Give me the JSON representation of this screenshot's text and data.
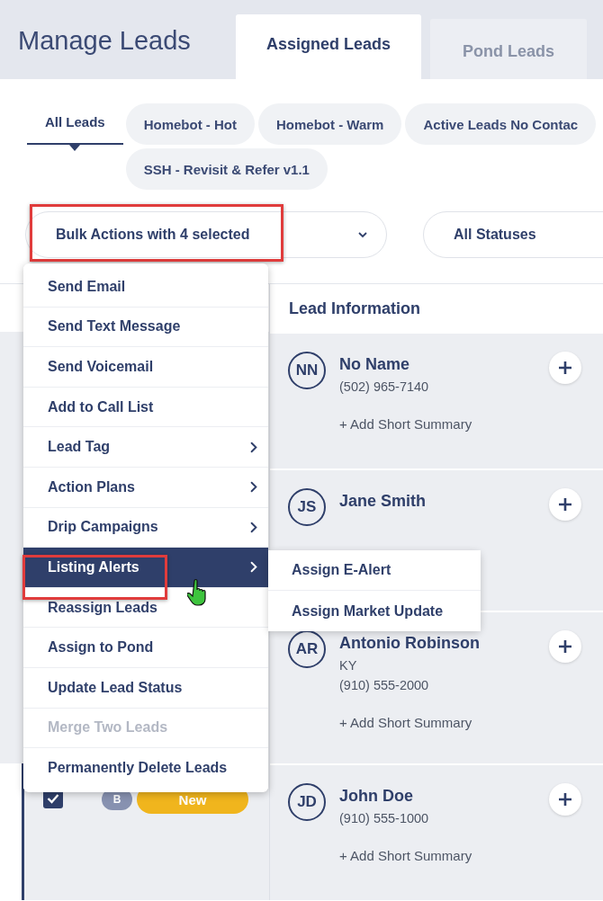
{
  "page_title": "Manage Leads",
  "tabs": [
    {
      "label": "Assigned Leads",
      "selected": true
    },
    {
      "label": "Pond Leads",
      "selected": false
    }
  ],
  "filters": [
    {
      "label": "All Leads",
      "selected": true
    },
    {
      "label": "Homebot - Hot",
      "selected": false
    },
    {
      "label": "Homebot - Warm",
      "selected": false
    },
    {
      "label": "Active Leads No Contac",
      "selected": false
    },
    {
      "label": "SSH - Revisit & Refer v1.1",
      "selected": false
    }
  ],
  "bulk_actions": {
    "value": "Bulk Actions with 4 selected",
    "highlighted": true
  },
  "status_filter": {
    "value": "All Statuses"
  },
  "table": {
    "column_header": "Lead Information",
    "leads": [
      {
        "initials": "NN",
        "name": "No Name",
        "lines": [
          "(502) 965-7140"
        ],
        "summary_link": "+ Add Short Summary"
      },
      {
        "initials": "JS",
        "name": "Jane Smith"
      },
      {
        "initials": "AR",
        "name": "Antonio Robinson",
        "lines": [
          "KY",
          "(910) 555-2000"
        ],
        "summary_link": "+ Add Short Summary"
      },
      {
        "initials": "JD",
        "name": "John Doe",
        "lines": [
          "(910) 555-1000"
        ],
        "summary_link": "+ Add Short Summary",
        "checked": true,
        "badge": "B",
        "status": "New"
      }
    ]
  },
  "bulk_menu": [
    {
      "label": "Send Email",
      "has_submenu": false,
      "selected": false,
      "disabled": false
    },
    {
      "label": "Send Text Message",
      "has_submenu": false,
      "selected": false,
      "disabled": false
    },
    {
      "label": "Send Voicemail",
      "has_submenu": false,
      "selected": false,
      "disabled": false
    },
    {
      "label": "Add to Call List",
      "has_submenu": false,
      "selected": false,
      "disabled": false
    },
    {
      "label": "Lead Tag",
      "has_submenu": true,
      "selected": false,
      "disabled": false
    },
    {
      "label": "Action Plans",
      "has_submenu": true,
      "selected": false,
      "disabled": false
    },
    {
      "label": "Drip Campaigns",
      "has_submenu": true,
      "selected": false,
      "disabled": false
    },
    {
      "label": "Listing Alerts",
      "has_submenu": true,
      "selected": true,
      "disabled": false,
      "highlighted": true
    },
    {
      "label": "Reassign Leads",
      "has_submenu": false,
      "selected": false,
      "disabled": false
    },
    {
      "label": "Assign to Pond",
      "has_submenu": false,
      "selected": false,
      "disabled": false
    },
    {
      "label": "Update Lead Status",
      "has_submenu": false,
      "selected": false,
      "disabled": false
    },
    {
      "label": "Merge Two Leads",
      "has_submenu": false,
      "selected": false,
      "disabled": true
    },
    {
      "label": "Permanently Delete Leads",
      "has_submenu": false,
      "selected": false,
      "disabled": false
    }
  ],
  "submenu": [
    "Assign E-Alert",
    "Assign Market Update"
  ]
}
